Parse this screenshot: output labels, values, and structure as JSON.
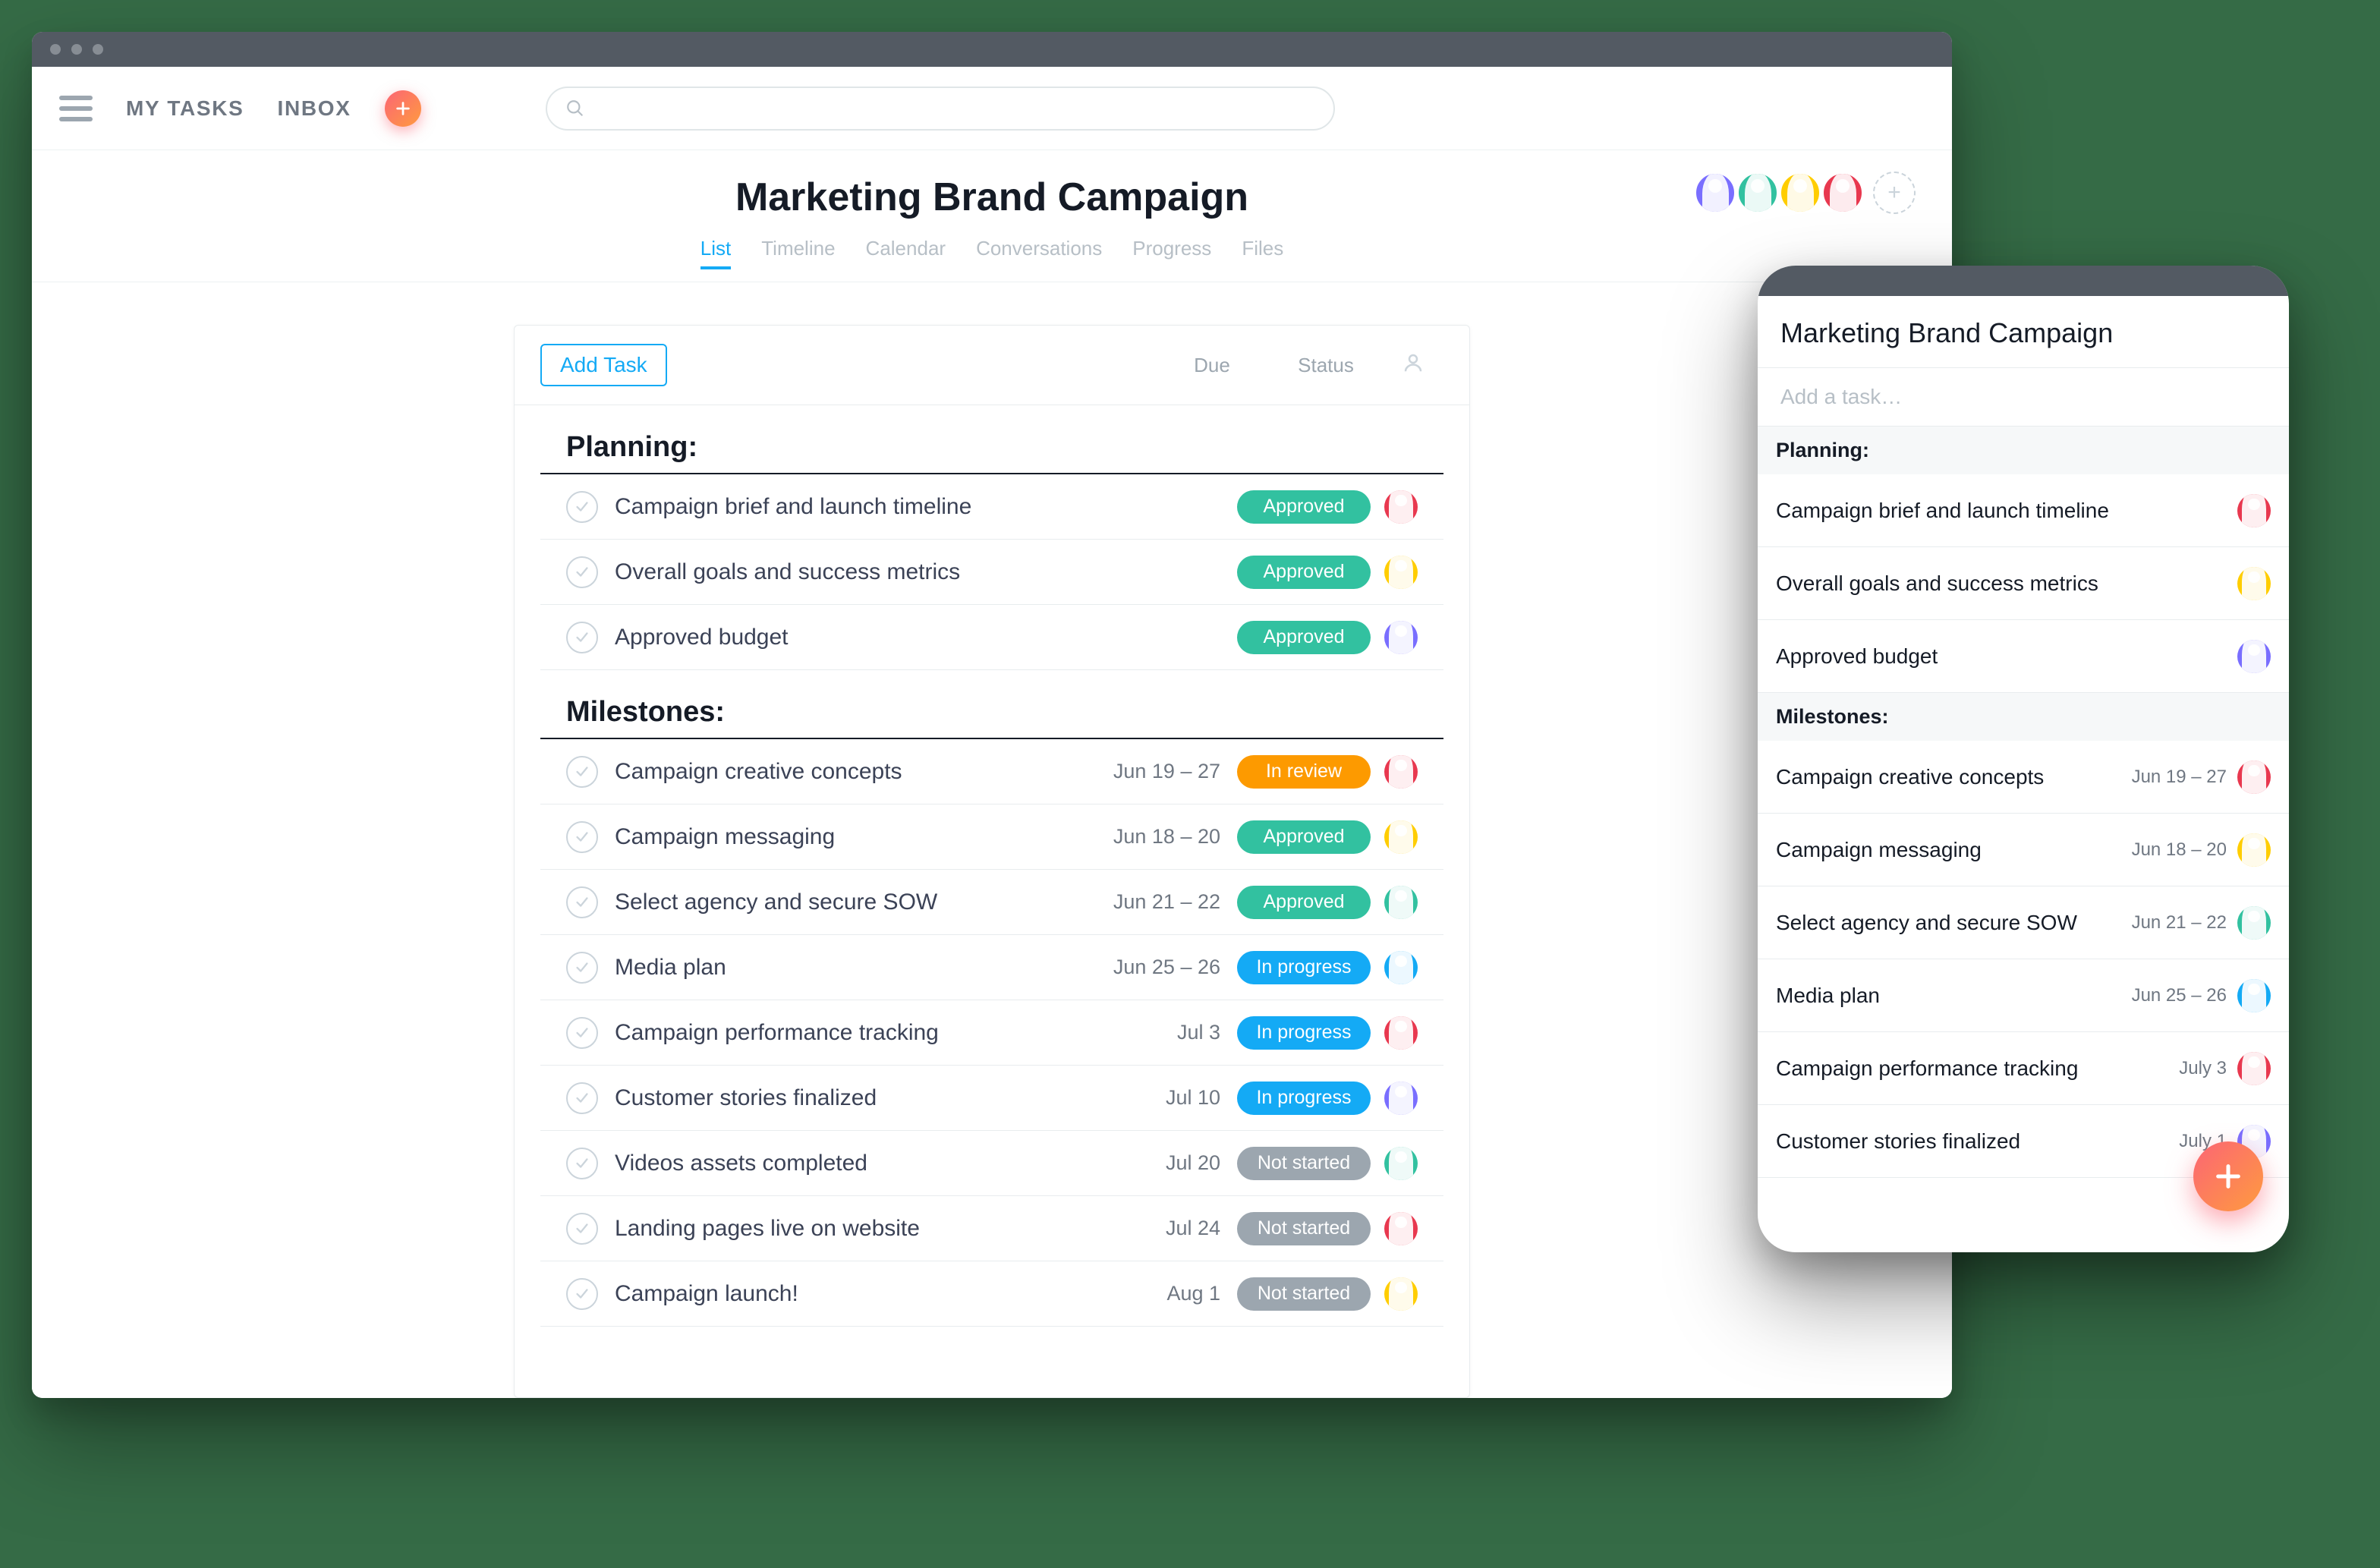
{
  "window": {
    "dots": 3
  },
  "toolbar": {
    "my_tasks": "MY TASKS",
    "inbox": "INBOX",
    "search_placeholder": ""
  },
  "header": {
    "title": "Marketing Brand Campaign",
    "tabs": [
      "List",
      "Timeline",
      "Calendar",
      "Conversations",
      "Progress",
      "Files"
    ],
    "active_tab": 0,
    "avatars": [
      "purple",
      "teal",
      "yellow",
      "red"
    ]
  },
  "panel": {
    "add_task": "Add Task",
    "cols": {
      "due": "Due",
      "status": "Status"
    }
  },
  "statuses": {
    "approved": "Approved",
    "review": "In review",
    "progress": "In progress",
    "notstarted": "Not started"
  },
  "sections": [
    {
      "title": "Planning:",
      "tasks": [
        {
          "name": "Campaign brief and launch timeline",
          "due": "",
          "status": "approved",
          "avatar": "red"
        },
        {
          "name": "Overall goals and success metrics",
          "due": "",
          "status": "approved",
          "avatar": "yellow"
        },
        {
          "name": "Approved budget",
          "due": "",
          "status": "approved",
          "avatar": "purple"
        }
      ]
    },
    {
      "title": "Milestones:",
      "tasks": [
        {
          "name": "Campaign creative concepts",
          "due": "Jun 19 – 27",
          "status": "review",
          "avatar": "red"
        },
        {
          "name": "Campaign messaging",
          "due": "Jun 18 – 20",
          "status": "approved",
          "avatar": "yellow"
        },
        {
          "name": "Select agency and secure SOW",
          "due": "Jun 21 – 22",
          "status": "approved",
          "avatar": "teal"
        },
        {
          "name": "Media plan",
          "due": "Jun 25 – 26",
          "status": "progress",
          "avatar": "blue"
        },
        {
          "name": "Campaign performance tracking",
          "due": "Jul 3",
          "status": "progress",
          "avatar": "red"
        },
        {
          "name": "Customer stories finalized",
          "due": "Jul 10",
          "status": "progress",
          "avatar": "purple"
        },
        {
          "name": "Videos assets completed",
          "due": "Jul 20",
          "status": "notstarted",
          "avatar": "teal"
        },
        {
          "name": "Landing pages live on website",
          "due": "Jul 24",
          "status": "notstarted",
          "avatar": "red"
        },
        {
          "name": "Campaign launch!",
          "due": "Aug 1",
          "status": "notstarted",
          "avatar": "yellow"
        }
      ]
    }
  ],
  "mobile": {
    "title": "Marketing Brand Campaign",
    "add_placeholder": "Add a task…",
    "sections": [
      {
        "title": "Planning:",
        "tasks": [
          {
            "name": "Campaign brief and launch timeline",
            "due": "",
            "avatar": "red"
          },
          {
            "name": "Overall goals and success metrics",
            "due": "",
            "avatar": "yellow"
          },
          {
            "name": "Approved budget",
            "due": "",
            "avatar": "purple"
          }
        ]
      },
      {
        "title": "Milestones:",
        "tasks": [
          {
            "name": "Campaign creative concepts",
            "due": "Jun 19 – 27",
            "avatar": "red"
          },
          {
            "name": "Campaign messaging",
            "due": "Jun 18 – 20",
            "avatar": "yellow"
          },
          {
            "name": "Select agency and secure SOW",
            "due": "Jun 21 – 22",
            "avatar": "teal"
          },
          {
            "name": "Media plan",
            "due": "Jun 25 – 26",
            "avatar": "blue"
          },
          {
            "name": "Campaign performance tracking",
            "due": "July 3",
            "avatar": "red"
          },
          {
            "name": "Customer stories finalized",
            "due": "July 1",
            "avatar": "purple"
          }
        ]
      }
    ]
  },
  "avatar_colors": {
    "purple": "#796eff",
    "teal": "#32c1a0",
    "yellow": "#ffcd00",
    "red": "#e8384f",
    "blue": "#14aaf5"
  }
}
